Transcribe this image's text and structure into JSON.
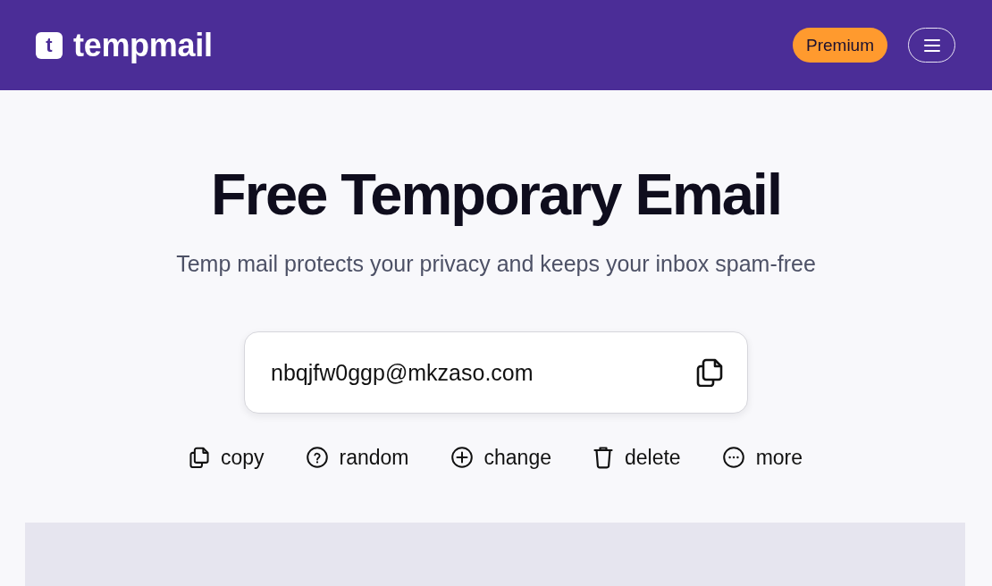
{
  "header": {
    "logo": {
      "mark": "t",
      "name": "tempmail"
    },
    "premium_button": "Premium"
  },
  "hero": {
    "title": "Free Temporary Email",
    "subtitle": "Temp mail protects your privacy and keeps your inbox spam-free"
  },
  "email_field": {
    "value": "nbqjfw0ggp@mkzaso.com"
  },
  "actions": [
    {
      "kind": "copy",
      "label": "copy"
    },
    {
      "kind": "random",
      "label": "random"
    },
    {
      "kind": "change",
      "label": "change"
    },
    {
      "kind": "delete",
      "label": "delete"
    },
    {
      "kind": "more",
      "label": "more"
    }
  ]
}
